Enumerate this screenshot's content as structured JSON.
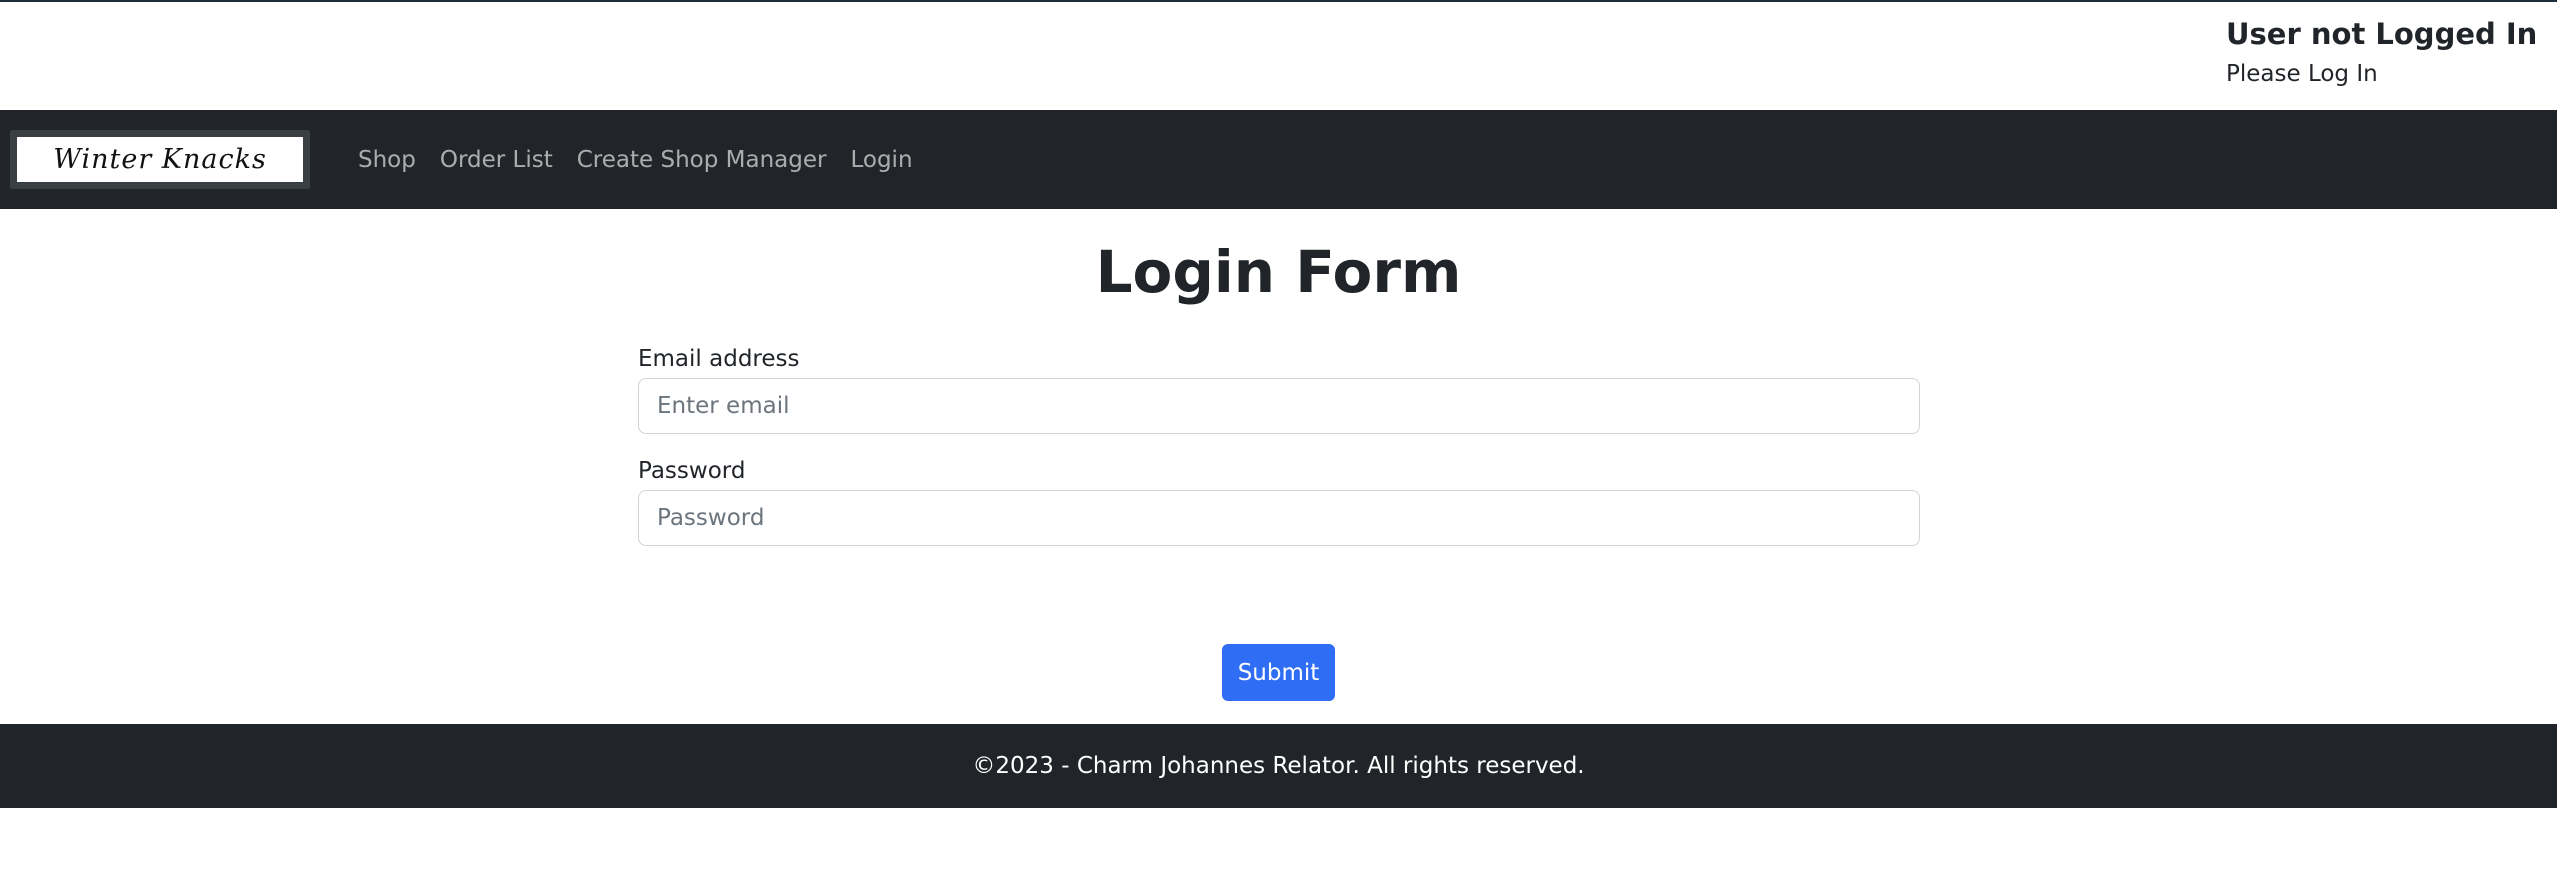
{
  "user_status": {
    "title": "User not Logged In",
    "subtitle": "Please Log In"
  },
  "navbar": {
    "brand": "Winter Knacks",
    "links": [
      "Shop",
      "Order List",
      "Create Shop Manager",
      "Login"
    ]
  },
  "main": {
    "title": "Login Form",
    "email_label": "Email address",
    "email_placeholder": "Enter email",
    "email_value": "",
    "password_label": "Password",
    "password_placeholder": "Password",
    "password_value": "",
    "submit_label": "Submit"
  },
  "footer": {
    "text": "©2023 - Charm Johannes Relator. All rights reserved."
  },
  "colors": {
    "navbar_bg": "#212529",
    "primary_button": "#2f6ef4"
  }
}
